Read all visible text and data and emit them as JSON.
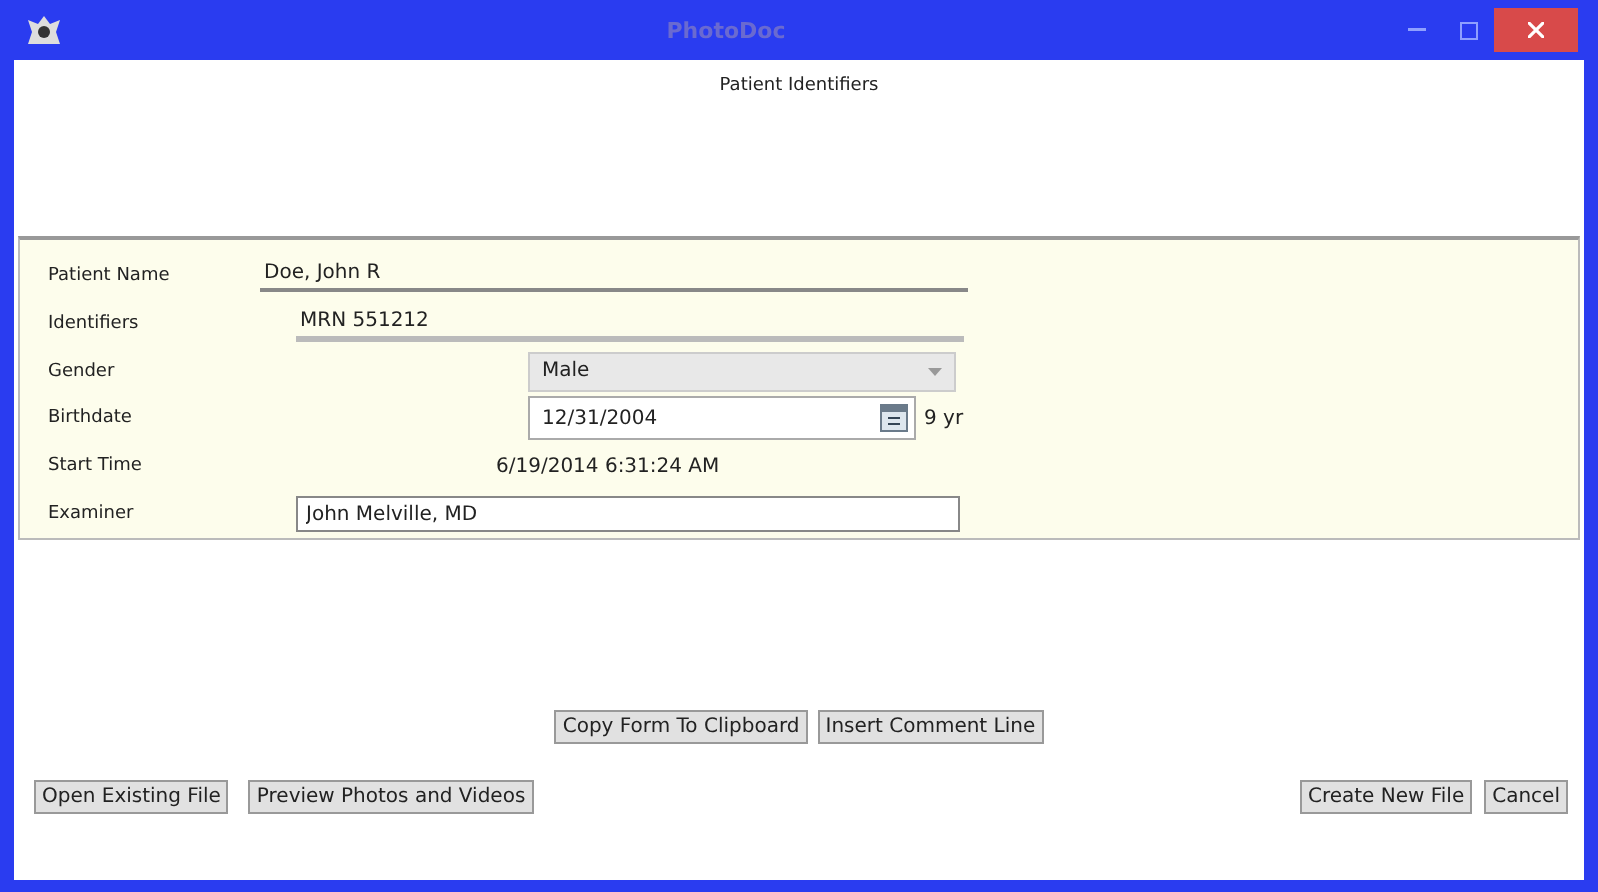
{
  "window": {
    "title": "PhotoDoc"
  },
  "header": "Patient Identifiers",
  "fields": [
    {
      "kind": "underline",
      "label": "Patient Name",
      "value": "Doe, John R"
    },
    {
      "kind": "underline-wide",
      "label": "Identifiers",
      "value": "MRN 551212"
    },
    {
      "kind": "dropdown",
      "label": "Gender",
      "value": "Male"
    },
    {
      "kind": "date",
      "label": "Birthdate",
      "value": "12/31/2004",
      "age": "9 yr"
    },
    {
      "kind": "readonly",
      "label": "Start Time",
      "value": "6/19/2014 6:31:24 AM"
    },
    {
      "kind": "input",
      "label": "Examiner",
      "value": "John Melville, MD"
    }
  ],
  "middle_buttons": [
    "Copy Form To Clipboard",
    "Insert Comment Line"
  ],
  "left_buttons": [
    "Open Existing File",
    "Preview Photos and Videos"
  ],
  "right_buttons": [
    "Create New File",
    "Cancel"
  ]
}
